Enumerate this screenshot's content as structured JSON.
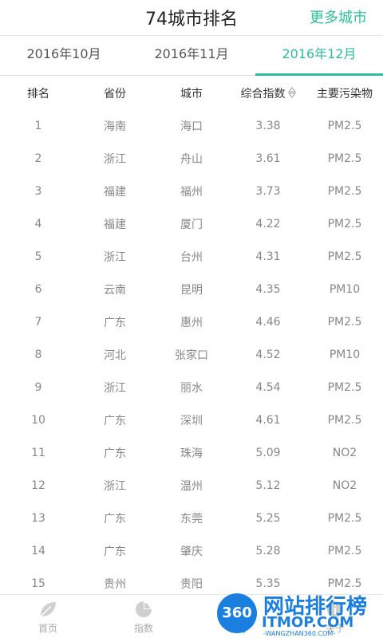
{
  "header": {
    "title": "74城市排名",
    "more": "更多城市"
  },
  "tabs": [
    {
      "label": "2016年10月",
      "active": false
    },
    {
      "label": "2016年11月",
      "active": false
    },
    {
      "label": "2016年12月",
      "active": true
    }
  ],
  "table": {
    "columns": [
      "排名",
      "省份",
      "城市",
      "综合指数",
      "主要污染物"
    ],
    "rows": [
      [
        "1",
        "海南",
        "海口",
        "3.38",
        "PM2.5"
      ],
      [
        "2",
        "浙江",
        "舟山",
        "3.61",
        "PM2.5"
      ],
      [
        "3",
        "福建",
        "福州",
        "3.73",
        "PM2.5"
      ],
      [
        "4",
        "福建",
        "厦门",
        "4.22",
        "PM2.5"
      ],
      [
        "5",
        "浙江",
        "台州",
        "4.31",
        "PM2.5"
      ],
      [
        "6",
        "云南",
        "昆明",
        "4.35",
        "PM10"
      ],
      [
        "7",
        "广东",
        "惠州",
        "4.46",
        "PM2.5"
      ],
      [
        "8",
        "河北",
        "张家口",
        "4.52",
        "PM10"
      ],
      [
        "9",
        "浙江",
        "丽水",
        "4.54",
        "PM2.5"
      ],
      [
        "10",
        "广东",
        "深圳",
        "4.61",
        "PM2.5"
      ],
      [
        "11",
        "广东",
        "珠海",
        "5.09",
        "NO2"
      ],
      [
        "12",
        "浙江",
        "温州",
        "5.12",
        "NO2"
      ],
      [
        "13",
        "广东",
        "东莞",
        "5.25",
        "PM2.5"
      ],
      [
        "14",
        "广东",
        "肇庆",
        "5.28",
        "PM2.5"
      ],
      [
        "15",
        "贵州",
        "贵阳",
        "5.35",
        "PM2.5"
      ]
    ]
  },
  "nav": [
    {
      "label": "首页",
      "icon": "leaf-icon"
    },
    {
      "label": "指数",
      "icon": "pie-chart-icon"
    },
    {
      "label": "排序",
      "icon": "ranking-icon"
    },
    {
      "label": "关于",
      "icon": "about-icon"
    }
  ],
  "watermark": {
    "badge": "360",
    "main": "网站排行榜",
    "brand": "ITMOP.COM",
    "sub": "-WANGZHAN360.COM-"
  },
  "colors": {
    "accent": "#2bbf9a",
    "watermark": "#1b7fe0"
  }
}
